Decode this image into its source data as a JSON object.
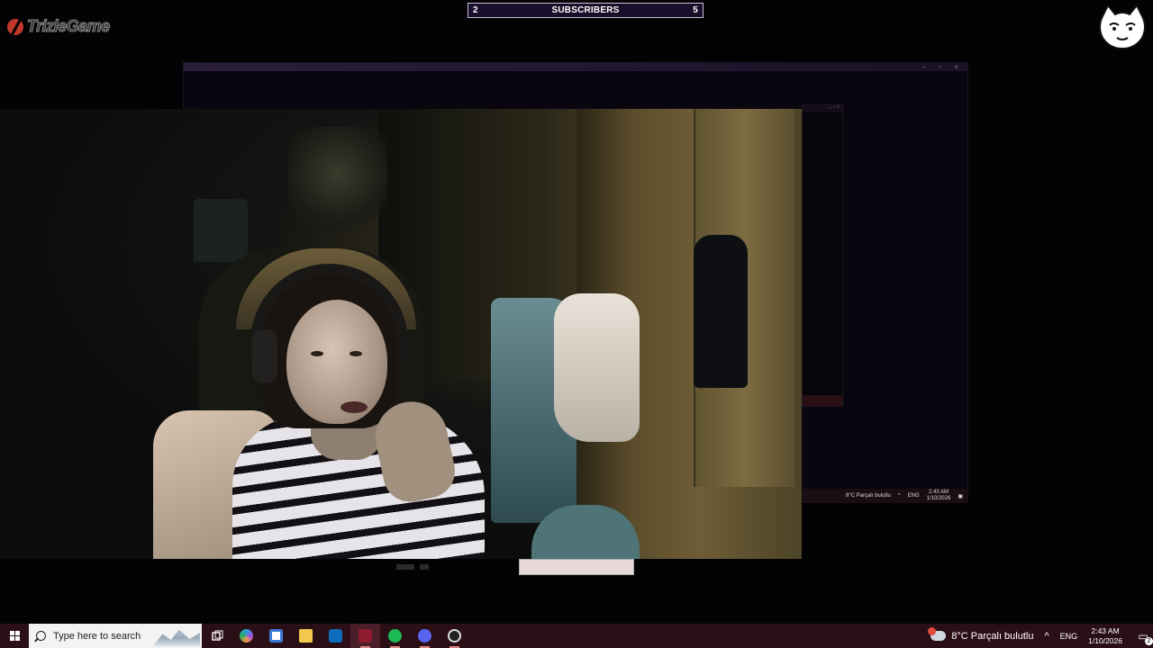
{
  "overlay": {
    "subscribers_title": "SUBSCRIBERS",
    "subscribers_left": "2",
    "subscribers_right": "5"
  },
  "mini_tray": {
    "weather": "8°C Parçalı bulutlu",
    "lang": "ENG",
    "time": "2:43 AM",
    "date": "1/10/2026"
  },
  "taskbar": {
    "search_placeholder": "Type here to search",
    "icons": [
      "task-view-icon",
      "copilot-icon",
      "store-icon",
      "file-explorer-icon",
      "outlook-icon",
      "red-app-icon",
      "spotify-icon",
      "discord-icon",
      "obs-icon"
    ],
    "weather_text": "8°C  Parçalı bulutlu",
    "lang": "ENG",
    "time": "2:43 AM",
    "date": "1/10/2026",
    "notification_count": "2"
  },
  "colors": {
    "taskbar_bg": "#2b0f17",
    "overlay_bg": "#1a0f2a",
    "brand_red": "#c0392b"
  }
}
